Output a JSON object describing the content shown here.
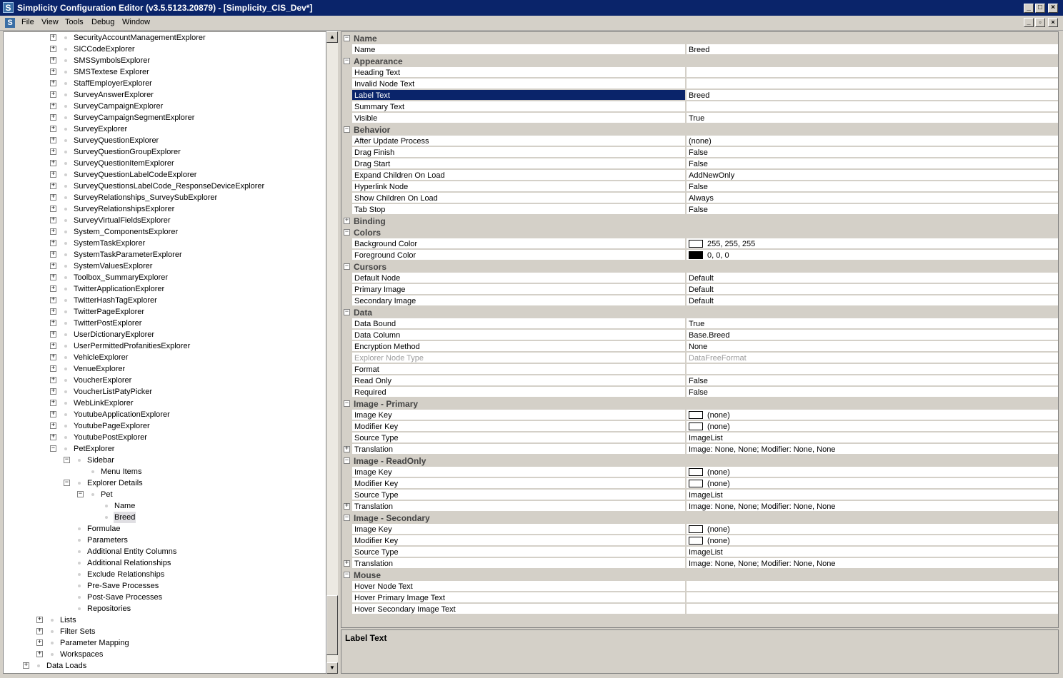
{
  "window": {
    "title": "Simplicity Configuration Editor (v3.5.5123.20879) - [Simplicity_CIS_Dev*]",
    "app_icon_glyph": "S"
  },
  "menu": [
    "File",
    "View",
    "Tools",
    "Debug",
    "Window"
  ],
  "tree": [
    {
      "label": "SecurityAccountManagementExplorer",
      "level": 3,
      "expander": "+"
    },
    {
      "label": "SICCodeExplorer",
      "level": 3,
      "expander": "+"
    },
    {
      "label": "SMSSymbolsExplorer",
      "level": 3,
      "expander": "+"
    },
    {
      "label": "SMSTextese Explorer",
      "level": 3,
      "expander": "+"
    },
    {
      "label": "StaffEmployerExplorer",
      "level": 3,
      "expander": "+"
    },
    {
      "label": "SurveyAnswerExplorer",
      "level": 3,
      "expander": "+"
    },
    {
      "label": "SurveyCampaignExplorer",
      "level": 3,
      "expander": "+"
    },
    {
      "label": "SurveyCampaignSegmentExplorer",
      "level": 3,
      "expander": "+"
    },
    {
      "label": "SurveyExplorer",
      "level": 3,
      "expander": "+"
    },
    {
      "label": "SurveyQuestionExplorer",
      "level": 3,
      "expander": "+"
    },
    {
      "label": "SurveyQuestionGroupExplorer",
      "level": 3,
      "expander": "+"
    },
    {
      "label": "SurveyQuestionItemExplorer",
      "level": 3,
      "expander": "+"
    },
    {
      "label": "SurveyQuestionLabelCodeExplorer",
      "level": 3,
      "expander": "+"
    },
    {
      "label": "SurveyQuestionsLabelCode_ResponseDeviceExplorer",
      "level": 3,
      "expander": "+"
    },
    {
      "label": "SurveyRelationships_SurveySubExplorer",
      "level": 3,
      "expander": "+"
    },
    {
      "label": "SurveyRelationshipsExplorer",
      "level": 3,
      "expander": "+"
    },
    {
      "label": "SurveyVirtualFieldsExplorer",
      "level": 3,
      "expander": "+"
    },
    {
      "label": "System_ComponentsExplorer",
      "level": 3,
      "expander": "+"
    },
    {
      "label": "SystemTaskExplorer",
      "level": 3,
      "expander": "+"
    },
    {
      "label": "SystemTaskParameterExplorer",
      "level": 3,
      "expander": "+"
    },
    {
      "label": "SystemValuesExplorer",
      "level": 3,
      "expander": "+"
    },
    {
      "label": "Toolbox_SummaryExplorer",
      "level": 3,
      "expander": "+"
    },
    {
      "label": "TwitterApplicationExplorer",
      "level": 3,
      "expander": "+"
    },
    {
      "label": "TwitterHashTagExplorer",
      "level": 3,
      "expander": "+"
    },
    {
      "label": "TwitterPageExplorer",
      "level": 3,
      "expander": "+"
    },
    {
      "label": "TwitterPostExplorer",
      "level": 3,
      "expander": "+"
    },
    {
      "label": "UserDictionaryExplorer",
      "level": 3,
      "expander": "+"
    },
    {
      "label": "UserPermittedProfanitiesExplorer",
      "level": 3,
      "expander": "+"
    },
    {
      "label": "VehicleExplorer",
      "level": 3,
      "expander": "+"
    },
    {
      "label": "VenueExplorer",
      "level": 3,
      "expander": "+"
    },
    {
      "label": "VoucherExplorer",
      "level": 3,
      "expander": "+"
    },
    {
      "label": "VoucherListPatyPicker",
      "level": 3,
      "expander": "+"
    },
    {
      "label": "WebLinkExplorer",
      "level": 3,
      "expander": "+"
    },
    {
      "label": "YoutubeApplicationExplorer",
      "level": 3,
      "expander": "+"
    },
    {
      "label": "YoutubePageExplorer",
      "level": 3,
      "expander": "+"
    },
    {
      "label": "YoutubePostExplorer",
      "level": 3,
      "expander": "+"
    },
    {
      "label": "PetExplorer",
      "level": 3,
      "expander": "-"
    },
    {
      "label": "Sidebar",
      "level": 4,
      "expander": "-"
    },
    {
      "label": "Menu Items",
      "level": 5,
      "expander": ""
    },
    {
      "label": "Explorer Details",
      "level": 4,
      "expander": "-"
    },
    {
      "label": "Pet",
      "level": 5,
      "expander": "-"
    },
    {
      "label": "Name",
      "level": 6,
      "expander": ""
    },
    {
      "label": "Breed",
      "level": 6,
      "expander": "",
      "selected": true
    },
    {
      "label": "Formulae",
      "level": 4,
      "expander": ""
    },
    {
      "label": "Parameters",
      "level": 4,
      "expander": ""
    },
    {
      "label": "Additional Entity Columns",
      "level": 4,
      "expander": ""
    },
    {
      "label": "Additional Relationships",
      "level": 4,
      "expander": ""
    },
    {
      "label": "Exclude Relationships",
      "level": 4,
      "expander": ""
    },
    {
      "label": "Pre-Save Processes",
      "level": 4,
      "expander": ""
    },
    {
      "label": "Post-Save Processes",
      "level": 4,
      "expander": ""
    },
    {
      "label": "Repositories",
      "level": 4,
      "expander": ""
    },
    {
      "label": "Lists",
      "level": 2,
      "expander": "+"
    },
    {
      "label": "Filter Sets",
      "level": 2,
      "expander": "+"
    },
    {
      "label": "Parameter Mapping",
      "level": 2,
      "expander": "+"
    },
    {
      "label": "Workspaces",
      "level": 2,
      "expander": "+"
    },
    {
      "label": "Data Loads",
      "level": 1,
      "expander": "+"
    }
  ],
  "properties": [
    {
      "type": "cat",
      "name": "Name",
      "expander": "-"
    },
    {
      "type": "prop",
      "name": "Name",
      "value": "Breed"
    },
    {
      "type": "cat",
      "name": "Appearance",
      "expander": "-"
    },
    {
      "type": "prop",
      "name": "Heading Text",
      "value": ""
    },
    {
      "type": "prop",
      "name": "Invalid Node Text",
      "value": ""
    },
    {
      "type": "prop",
      "name": "Label Text",
      "value": "Breed",
      "selected": true
    },
    {
      "type": "prop",
      "name": "Summary Text",
      "value": ""
    },
    {
      "type": "prop",
      "name": "Visible",
      "value": "True"
    },
    {
      "type": "cat",
      "name": "Behavior",
      "expander": "-"
    },
    {
      "type": "prop",
      "name": "After Update Process",
      "value": "(none)"
    },
    {
      "type": "prop",
      "name": "Drag Finish",
      "value": "False"
    },
    {
      "type": "prop",
      "name": "Drag Start",
      "value": "False"
    },
    {
      "type": "prop",
      "name": "Expand Children On Load",
      "value": "AddNewOnly"
    },
    {
      "type": "prop",
      "name": "Hyperlink Node",
      "value": "False"
    },
    {
      "type": "prop",
      "name": "Show Children On Load",
      "value": "Always"
    },
    {
      "type": "prop",
      "name": "Tab Stop",
      "value": "False"
    },
    {
      "type": "cat",
      "name": "Binding",
      "expander": "+"
    },
    {
      "type": "cat",
      "name": "Colors",
      "expander": "-"
    },
    {
      "type": "prop",
      "name": "Background Color",
      "value": "255, 255, 255",
      "swatch": "#ffffff"
    },
    {
      "type": "prop",
      "name": "Foreground Color",
      "value": "0, 0, 0",
      "swatch": "#000000"
    },
    {
      "type": "cat",
      "name": "Cursors",
      "expander": "-"
    },
    {
      "type": "prop",
      "name": "Default Node",
      "value": "Default"
    },
    {
      "type": "prop",
      "name": "Primary Image",
      "value": "Default"
    },
    {
      "type": "prop",
      "name": "Secondary Image",
      "value": "Default"
    },
    {
      "type": "cat",
      "name": "Data",
      "expander": "-"
    },
    {
      "type": "prop",
      "name": "Data Bound",
      "value": "True"
    },
    {
      "type": "prop",
      "name": "Data Column",
      "value": "Base.Breed"
    },
    {
      "type": "prop",
      "name": "Encryption Method",
      "value": "None"
    },
    {
      "type": "prop",
      "name": "Explorer Node Type",
      "value": "DataFreeFormat",
      "disabled": true
    },
    {
      "type": "prop",
      "name": "Format",
      "value": ""
    },
    {
      "type": "prop",
      "name": "Read Only",
      "value": "False"
    },
    {
      "type": "prop",
      "name": "Required",
      "value": "False"
    },
    {
      "type": "cat",
      "name": "Image - Primary",
      "expander": "-"
    },
    {
      "type": "prop",
      "name": "Image Key",
      "value": "(none)",
      "swatch": "#ffffff"
    },
    {
      "type": "prop",
      "name": "Modifier Key",
      "value": "(none)",
      "swatch": "#ffffff"
    },
    {
      "type": "prop",
      "name": "Source Type",
      "value": "ImageList"
    },
    {
      "type": "prop",
      "name": "Translation",
      "value": "Image: None, None; Modifier: None, None",
      "expander": "+"
    },
    {
      "type": "cat",
      "name": "Image - ReadOnly",
      "expander": "-"
    },
    {
      "type": "prop",
      "name": "Image Key",
      "value": "(none)",
      "swatch": "#ffffff"
    },
    {
      "type": "prop",
      "name": "Modifier Key",
      "value": "(none)",
      "swatch": "#ffffff"
    },
    {
      "type": "prop",
      "name": "Source Type",
      "value": "ImageList"
    },
    {
      "type": "prop",
      "name": "Translation",
      "value": "Image: None, None; Modifier: None, None",
      "expander": "+"
    },
    {
      "type": "cat",
      "name": "Image - Secondary",
      "expander": "-"
    },
    {
      "type": "prop",
      "name": "Image Key",
      "value": "(none)",
      "swatch": "#ffffff"
    },
    {
      "type": "prop",
      "name": "Modifier Key",
      "value": "(none)",
      "swatch": "#ffffff"
    },
    {
      "type": "prop",
      "name": "Source Type",
      "value": "ImageList"
    },
    {
      "type": "prop",
      "name": "Translation",
      "value": "Image: None, None; Modifier: None, None",
      "expander": "+"
    },
    {
      "type": "cat",
      "name": "Mouse",
      "expander": "-"
    },
    {
      "type": "prop",
      "name": "Hover Node Text",
      "value": ""
    },
    {
      "type": "prop",
      "name": "Hover Primary Image Text",
      "value": ""
    },
    {
      "type": "prop",
      "name": "Hover Secondary Image Text",
      "value": ""
    }
  ],
  "help": {
    "title": "Label Text"
  },
  "colors": {
    "titlebar": "#0a246a",
    "selection": "#0a246a",
    "chrome": "#d4d0c8"
  }
}
